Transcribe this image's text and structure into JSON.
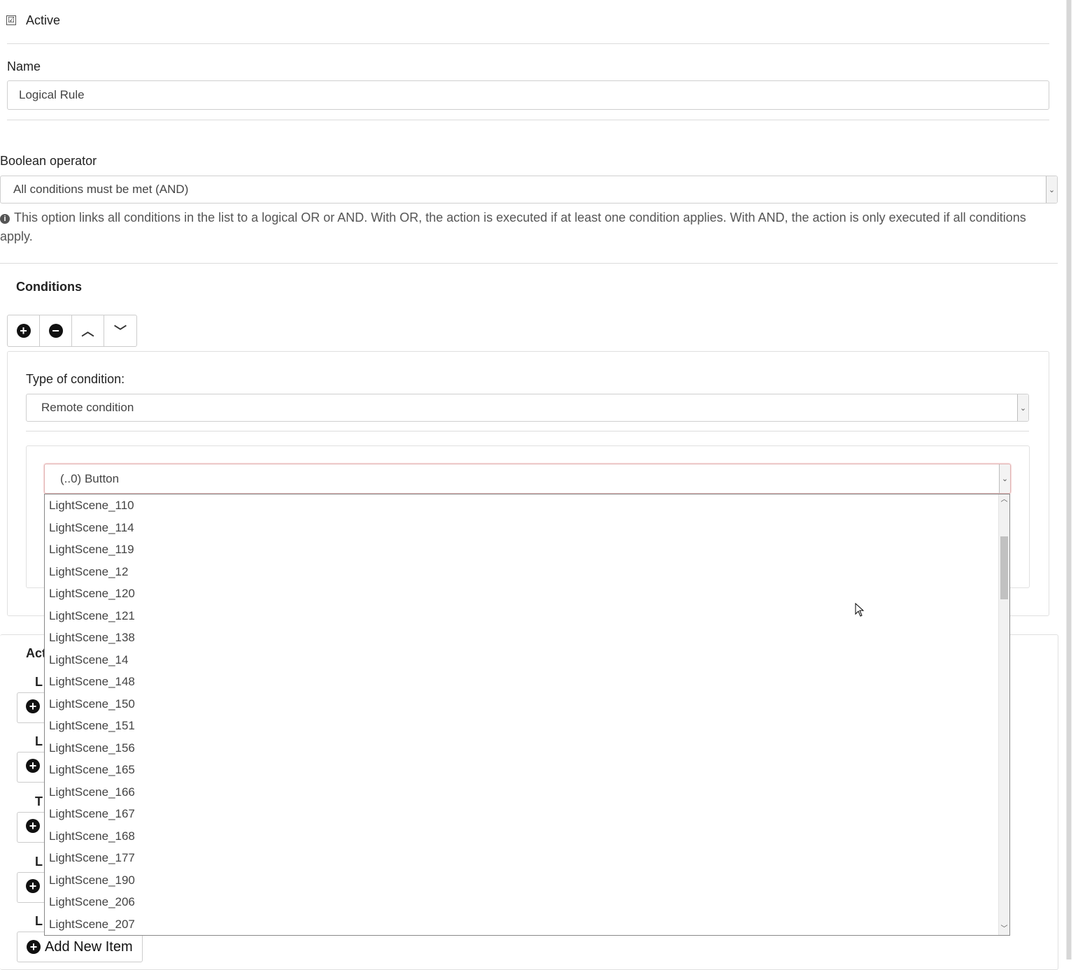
{
  "active": {
    "label": "Active",
    "checked_glyph": "☑"
  },
  "name": {
    "label": "Name",
    "value": "Logical Rule"
  },
  "boolean_operator": {
    "label": "Boolean operator",
    "selected": "All conditions must be met (AND)",
    "info": "This option links all conditions in the list to a logical OR or AND. With OR, the action is executed if at least one condition applies. With AND, the action is only executed if all conditions apply."
  },
  "conditions": {
    "title": "Conditions",
    "toolbar_icons": [
      "plus-circle-icon",
      "minus-circle-icon",
      "chevron-up-icon",
      "chevron-down-icon"
    ],
    "type_label": "Type of condition:",
    "type_selected": "Remote condition",
    "remote_select_value": "(..0) Button"
  },
  "dropdown_options": [
    "LightScene_110",
    "LightScene_114",
    "LightScene_119",
    "LightScene_12",
    "LightScene_120",
    "LightScene_121",
    "LightScene_138",
    "LightScene_14",
    "LightScene_148",
    "LightScene_150",
    "LightScene_151",
    "LightScene_156",
    "LightScene_165",
    "LightScene_166",
    "LightScene_167",
    "LightScene_168",
    "LightScene_177",
    "LightScene_190",
    "LightScene_206",
    "LightScene_207"
  ],
  "actions": {
    "title_fragment": "Act",
    "row_fragments": [
      "L",
      "L",
      "T",
      "L",
      "L"
    ],
    "add_new_label": "Add New Item"
  }
}
